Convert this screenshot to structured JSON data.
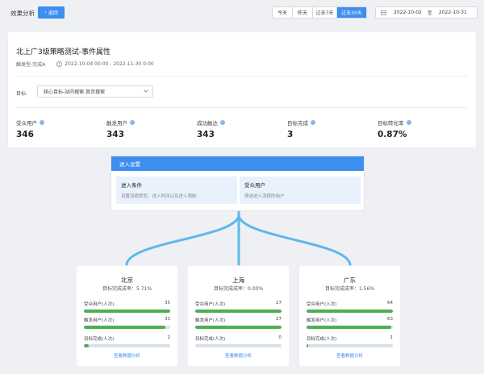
{
  "header": {
    "page_title": "效果分析",
    "back_label": "返回",
    "ranges": [
      {
        "label": "今天",
        "active": false
      },
      {
        "label": "昨天",
        "active": false
      },
      {
        "label": "过去7天",
        "active": false
      },
      {
        "label": "过去30天",
        "active": true
      }
    ],
    "date_start": "2022-10-02",
    "date_sep": "至",
    "date_end": "2022-10-31"
  },
  "strategy": {
    "title": "北上广3级策略测试-事件属性",
    "trigger": "触发型-完成A",
    "period": "2022-10-04 00:00 - 2022-11-30 0:00",
    "target_label": "目标:",
    "target_value": "核心目标-站内搜索:首页搜索"
  },
  "metrics": [
    {
      "label": "受众用户",
      "value": "346"
    },
    {
      "label": "触发用户",
      "value": "343"
    },
    {
      "label": "成功触达",
      "value": "343"
    },
    {
      "label": "目标完成",
      "value": "3"
    },
    {
      "label": "目标转化率",
      "value": "0.87%"
    }
  ],
  "entry": {
    "title": "进入设置",
    "left_title": "进入条件",
    "left_sub": "设置流程类型、进入时间以及进入限制",
    "right_title": "受众用户",
    "right_sub": "筛选进入流程的用户"
  },
  "regions": [
    {
      "name": "北京",
      "rate": "目标完成成率：5.71%",
      "rows": [
        {
          "label": "受众用户(人次)",
          "value": "35",
          "fill": 1.0
        },
        {
          "label": "触发用户(人次)",
          "value": "33",
          "fill": 0.943
        },
        {
          "label": "目标完成(人次)",
          "value": "2",
          "fill": 0.057
        }
      ],
      "link": "查看数据分析"
    },
    {
      "name": "上海",
      "rate": "目标完成成率：0.00%",
      "rows": [
        {
          "label": "受众用户(人次)",
          "value": "27",
          "fill": 1.0
        },
        {
          "label": "触发用户(人次)",
          "value": "27",
          "fill": 1.0
        },
        {
          "label": "目标完成(人次)",
          "value": "0",
          "fill": 0.0
        }
      ],
      "link": "查看数据分析"
    },
    {
      "name": "广东",
      "rate": "目标完成成率：1.56%",
      "rows": [
        {
          "label": "受众用户(人次)",
          "value": "64",
          "fill": 1.0
        },
        {
          "label": "触发用户(人次)",
          "value": "63",
          "fill": 0.984
        },
        {
          "label": "目标完成(人次)",
          "value": "1",
          "fill": 0.016
        }
      ],
      "link": "查看数据分析"
    }
  ],
  "colors": {
    "accent": "#3d8ef0",
    "bar": "#4caf50",
    "track": "#d9e2ec",
    "connector": "#5fb6ea"
  }
}
